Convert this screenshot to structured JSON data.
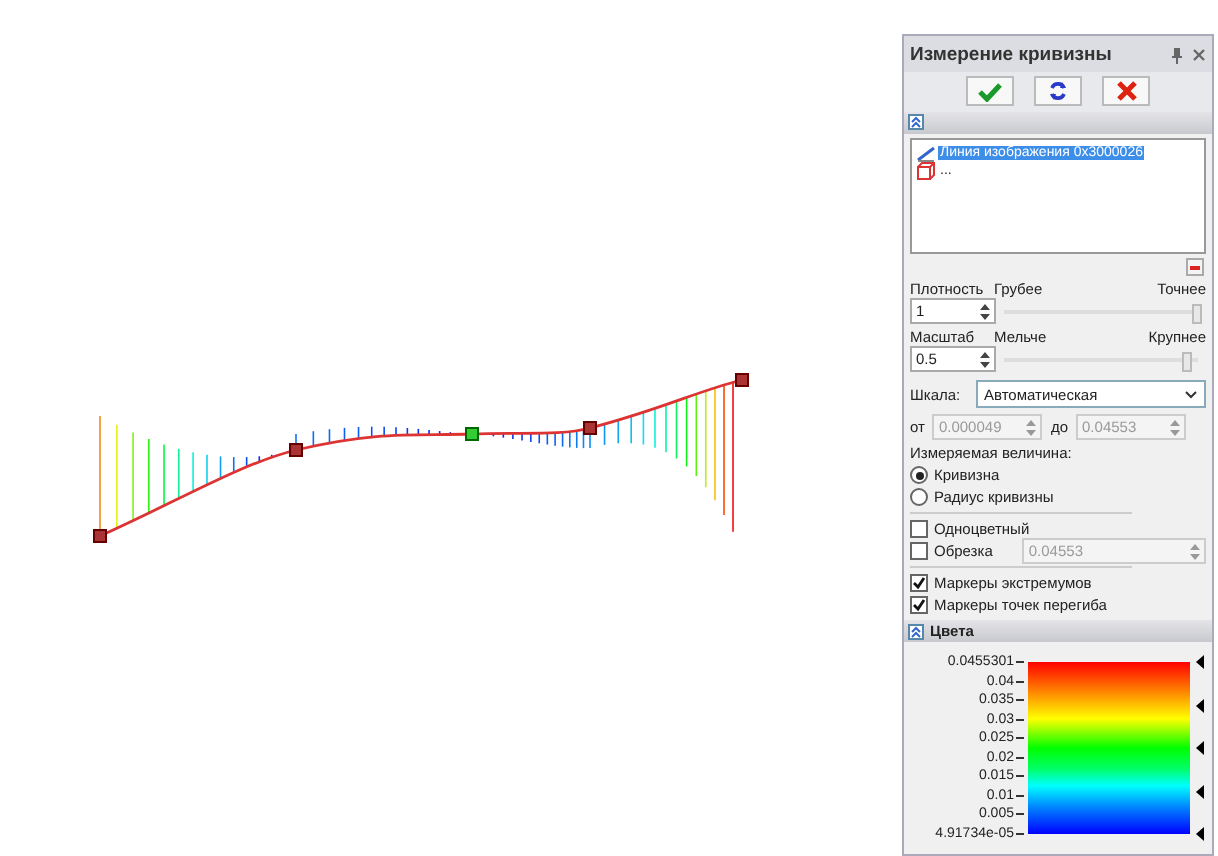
{
  "panel": {
    "title": "Измерение кривизны"
  },
  "objects": [
    {
      "label": "Линия изображения 0x3000026",
      "kind": "line",
      "selected": true
    },
    {
      "label": "...",
      "kind": "box",
      "selected": false
    }
  ],
  "density": {
    "label": "Плотность",
    "min_label": "Грубее",
    "max_label": "Точнее",
    "value": "1",
    "level": 1.0
  },
  "scale": {
    "label": "Масштаб",
    "min_label": "Мельче",
    "max_label": "Крупнее",
    "value": "0.5",
    "level": 0.95
  },
  "scale_type": {
    "label": "Шкала:",
    "value": "Автоматическая"
  },
  "range": {
    "from_label": "от",
    "from_value": "0.000049",
    "to_label": "до",
    "to_value": "0.04553",
    "disabled": true
  },
  "measured": {
    "label": "Измеряемая величина:",
    "options": [
      {
        "label": "Кривизна",
        "selected": true
      },
      {
        "label": "Радиус кривизны",
        "selected": false
      }
    ]
  },
  "options": [
    {
      "label": "Одноцветный",
      "checked": false
    },
    {
      "label": "Обрезка",
      "checked": false,
      "field": "0.04553"
    }
  ],
  "markers": [
    {
      "label": "Маркеры экстремумов",
      "checked": true
    },
    {
      "label": "Маркеры точек перегиба",
      "checked": true
    }
  ],
  "colors": {
    "title": "Цвета",
    "ticks": [
      "0.0455301",
      "0.04",
      "0.035",
      "0.03",
      "0.025",
      "0.02",
      "0.015",
      "0.01",
      "0.005",
      "4.91734e-05"
    ]
  }
}
